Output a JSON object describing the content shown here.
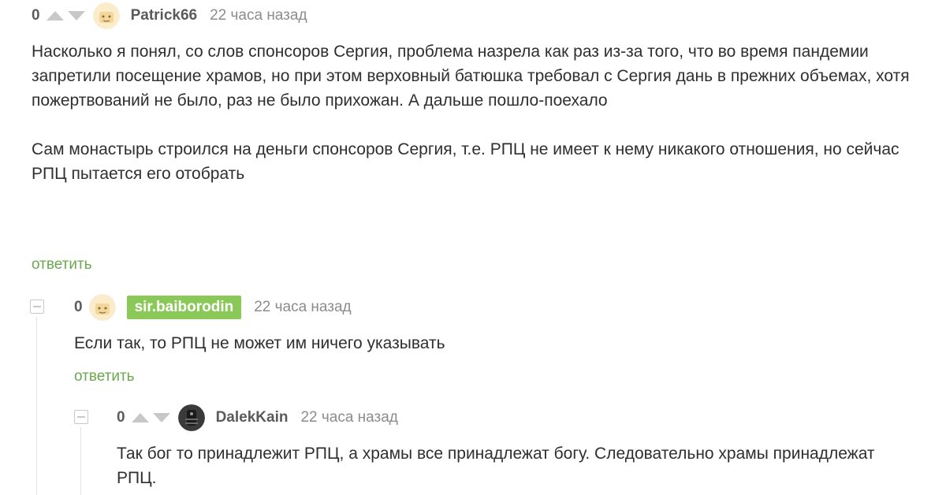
{
  "comment1": {
    "rating": "0",
    "username": "Patrick66",
    "timestamp": "22 часа назад",
    "paragraph1": "Насколько я понял, со слов спонсоров Сергия, проблема назрела как раз из-за того, что во время пандемии запретили посещение храмов, но при этом верховный батюшка требовал с Сергия дань в прежних объемах, хотя пожертвований не было, раз не было прихожан. А дальше пошло-поехало",
    "paragraph2": "Сам монастырь строился на деньги спонсоров Сергия, т.е. РПЦ не имеет к нему никакого отношения, но сейчас РПЦ пытается его отобрать",
    "reply_label": "ответить"
  },
  "comment2": {
    "rating": "0",
    "username": "sir.baiborodin",
    "timestamp": "22 часа назад",
    "text": "Если так, то РПЦ не может им ничего указывать",
    "reply_label": "ответить"
  },
  "comment3": {
    "rating": "0",
    "username": "DalekKain",
    "timestamp": "22 часа назад",
    "text": "Так бог то принадлежит РПЦ, а храмы все принадлежат богу. Следовательно храмы принадлежат РПЦ."
  },
  "colors": {
    "accent_green": "#6aa84f",
    "badge_green": "#8ac858",
    "vote_arrow": "#c8c8c8"
  }
}
